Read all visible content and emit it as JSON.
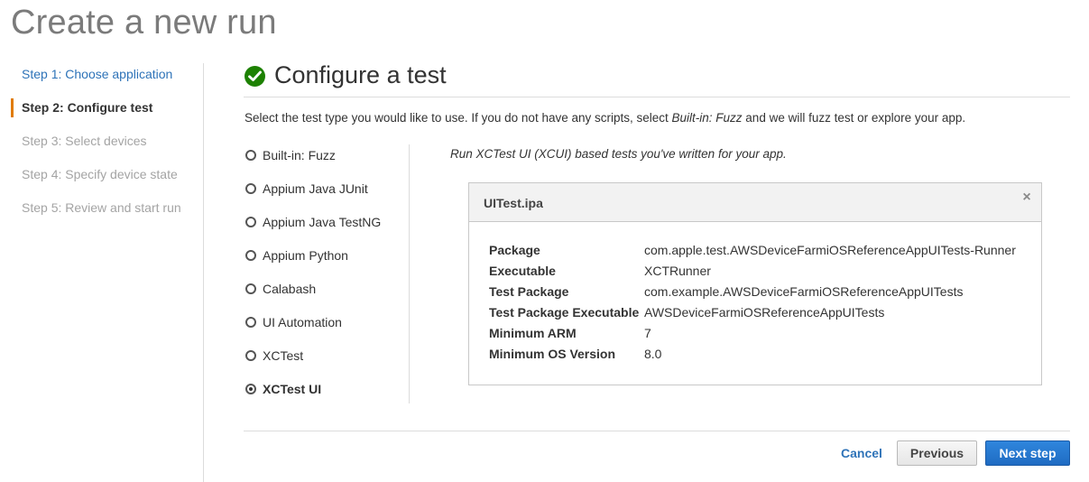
{
  "page": {
    "title": "Create a new run"
  },
  "steps": [
    {
      "label": "Step 1: Choose application",
      "state": "link"
    },
    {
      "label": "Step 2: Configure test",
      "state": "active"
    },
    {
      "label": "Step 3: Select devices",
      "state": "disabled"
    },
    {
      "label": "Step 4: Specify device state",
      "state": "disabled"
    },
    {
      "label": "Step 5: Review and start run",
      "state": "disabled"
    }
  ],
  "section": {
    "title": "Configure a test",
    "intro_prefix": "Select the test type you would like to use. If you do not have any scripts, select ",
    "intro_em": "Built-in: Fuzz",
    "intro_suffix": " and we will fuzz test or explore your app."
  },
  "test_types": [
    {
      "label": "Built-in: Fuzz",
      "selected": false
    },
    {
      "label": "Appium Java JUnit",
      "selected": false
    },
    {
      "label": "Appium Java TestNG",
      "selected": false
    },
    {
      "label": "Appium Python",
      "selected": false
    },
    {
      "label": "Calabash",
      "selected": false
    },
    {
      "label": "UI Automation",
      "selected": false
    },
    {
      "label": "XCTest",
      "selected": false
    },
    {
      "label": "XCTest UI",
      "selected": true
    }
  ],
  "type_description": "Run XCTest UI (XCUI) based tests you've written for your app.",
  "file": {
    "name": "UITest.ipa",
    "close_icon": "close-icon",
    "details": [
      {
        "key": "Package",
        "value": "com.apple.test.AWSDeviceFarmiOSReferenceAppUITests-Runner"
      },
      {
        "key": "Executable",
        "value": "XCTRunner"
      },
      {
        "key": "Test Package",
        "value": "com.example.AWSDeviceFarmiOSReferenceAppUITests"
      },
      {
        "key": "Test Package Executable",
        "value": "AWSDeviceFarmiOSReferenceAppUITests"
      },
      {
        "key": "Minimum ARM",
        "value": "7"
      },
      {
        "key": "Minimum OS Version",
        "value": "8.0"
      }
    ]
  },
  "actions": {
    "cancel": "Cancel",
    "previous": "Previous",
    "next": "Next step"
  },
  "colors": {
    "accent_orange": "#e07b00",
    "link_blue": "#2e73b8",
    "success_green": "#1d8102",
    "primary_button": "#1f6bc2"
  }
}
